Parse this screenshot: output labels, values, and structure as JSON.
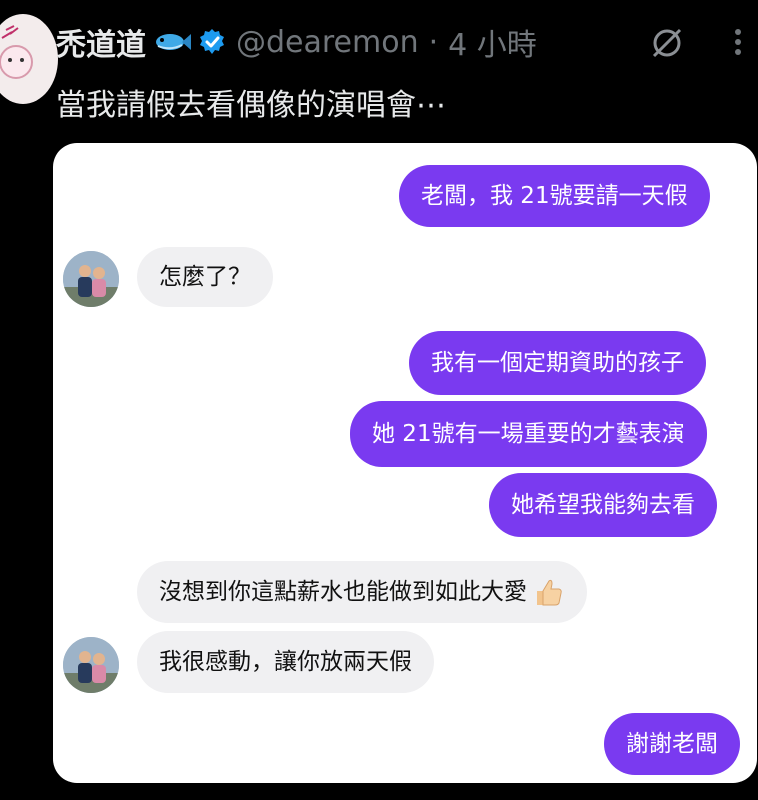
{
  "post": {
    "display_name": "禿道道",
    "handle": "@dearemon",
    "separator": "·",
    "time": "4 小時",
    "text": "當我請假去看偶像的演唱會⋯"
  },
  "icons": {
    "fish": "fish-emoji-icon",
    "verified": "verified-badge-icon",
    "mute": "mute-icon",
    "more": "more-icon",
    "thumbs_up": "thumbs-up-icon"
  },
  "colors": {
    "outgoing_bubble": "#7a3af0",
    "incoming_bubble": "#f0f0f2",
    "verified": "#1d9bf0",
    "background": "#000000"
  },
  "chat": {
    "messages": [
      {
        "side": "out",
        "text": "老闆，我 21號要請一天假"
      },
      {
        "side": "in",
        "text": "怎麼了？"
      },
      {
        "side": "out",
        "text": "我有一個定期資助的孩子"
      },
      {
        "side": "out",
        "text": "她 21號有一場重要的才藝表演"
      },
      {
        "side": "out",
        "text": "她希望我能夠去看"
      },
      {
        "side": "in",
        "text": "沒想到你這點薪水也能做到如此大愛"
      },
      {
        "side": "in",
        "text": "我很感動，讓你放兩天假"
      },
      {
        "side": "out",
        "text": "謝謝老闆"
      }
    ]
  }
}
